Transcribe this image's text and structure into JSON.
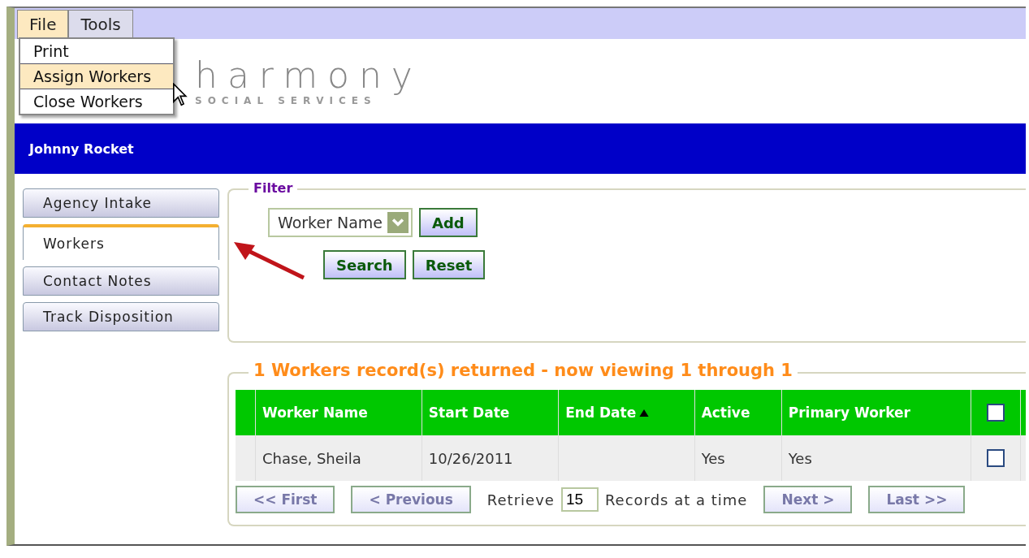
{
  "menu": [
    {
      "label": "File",
      "selected": true
    },
    {
      "label": "Tools",
      "selected": false
    }
  ],
  "dropdown": [
    {
      "label": "Print",
      "selected": false
    },
    {
      "label": "Assign Workers",
      "selected": true
    },
    {
      "label": "Close Workers",
      "selected": false
    }
  ],
  "logo": {
    "name": "harmony",
    "tagline": "SOCIAL SERVICES"
  },
  "header": {
    "user": "Johnny Rocket"
  },
  "sidebar": {
    "items": [
      {
        "label": "Agency Intake",
        "selected": false
      },
      {
        "label": "Workers",
        "selected": true
      },
      {
        "label": "Contact Notes",
        "selected": false
      },
      {
        "label": "Track Disposition",
        "selected": false
      }
    ]
  },
  "filter": {
    "legend": "Filter",
    "select": {
      "value": "Worker Name"
    },
    "buttons": [
      "Add",
      "Search",
      "Reset"
    ]
  },
  "results": {
    "legend": "1 Workers record(s) returned - now viewing 1 through 1",
    "columns": [
      {
        "label": "Worker Name",
        "sorted": false
      },
      {
        "label": "Start Date",
        "sorted": false
      },
      {
        "label": "End Date",
        "sorted": true
      },
      {
        "label": "Active",
        "sorted": false
      },
      {
        "label": "Primary Worker",
        "sorted": false
      }
    ],
    "header_checkbox": {
      "checked": false
    },
    "rows": [
      {
        "cells": [
          "Chase, Sheila",
          "10/26/2011",
          "",
          "Yes",
          "Yes"
        ],
        "checked": false
      }
    ],
    "pager": {
      "buttons": [
        {
          "label": "<< First",
          "disabled": true
        },
        {
          "label": "< Previous",
          "disabled": true
        },
        {
          "label": "Next >",
          "disabled": true
        },
        {
          "label": "Last >>",
          "disabled": true
        }
      ],
      "retrieve_label": "Retrieve",
      "page_size": "15",
      "suffix_label": "Records at a time"
    }
  }
}
